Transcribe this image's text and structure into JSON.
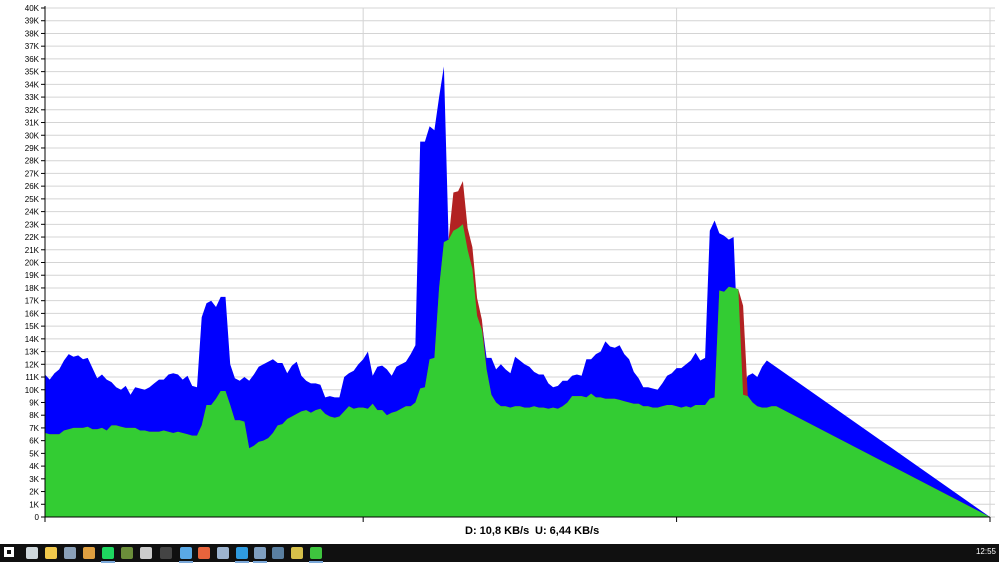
{
  "chart_data": {
    "type": "area",
    "title": "",
    "xlabel": "",
    "ylabel": "",
    "ylim": [
      0,
      40000
    ],
    "grid": true,
    "legend": "none",
    "y_ticks": [
      0,
      1000,
      2000,
      3000,
      4000,
      5000,
      6000,
      7000,
      8000,
      9000,
      10000,
      11000,
      12000,
      13000,
      14000,
      15000,
      16000,
      17000,
      18000,
      19000,
      20000,
      21000,
      22000,
      23000,
      24000,
      25000,
      26000,
      27000,
      28000,
      29000,
      30000,
      31000,
      32000,
      33000,
      34000,
      35000,
      36000,
      37000,
      38000,
      39000,
      40000
    ],
    "y_tick_labels": [
      "0",
      "1K",
      "2K",
      "3K",
      "4K",
      "5K",
      "6K",
      "7K",
      "8K",
      "9K",
      "10K",
      "11K",
      "12K",
      "13K",
      "14K",
      "15K",
      "16K",
      "17K",
      "18K",
      "19K",
      "20K",
      "21K",
      "22K",
      "23K",
      "24K",
      "25K",
      "26K",
      "27K",
      "28K",
      "29K",
      "30K",
      "31K",
      "32K",
      "33K",
      "34K",
      "35K",
      "36K",
      "37K",
      "38K",
      "39K",
      "40K"
    ],
    "x": [
      0,
      1,
      2,
      3,
      4,
      5,
      6,
      7,
      8,
      9,
      10,
      11,
      12,
      13,
      14,
      15,
      16,
      17,
      18,
      19,
      20,
      21,
      22,
      23,
      24,
      25,
      26,
      27,
      28,
      29,
      30,
      31,
      32,
      33,
      34,
      35,
      36,
      37,
      38,
      39,
      40,
      41,
      42,
      43,
      44,
      45,
      46,
      47,
      48,
      49,
      50,
      51,
      52,
      53,
      54,
      55,
      56,
      57,
      58,
      59,
      60,
      61,
      62,
      63,
      64,
      65,
      66,
      67,
      68,
      69,
      70,
      71,
      72,
      73,
      74,
      75,
      76,
      77,
      78,
      79,
      80,
      81,
      82,
      83,
      84,
      85,
      86,
      87,
      88,
      89,
      90,
      91,
      92,
      93,
      94,
      95,
      96,
      97,
      98,
      99,
      100,
      101,
      102,
      103,
      104,
      105,
      106,
      107,
      108,
      109,
      110,
      111,
      112,
      113,
      114,
      115,
      116,
      117,
      118,
      119,
      120,
      121,
      122,
      123,
      124,
      125,
      126,
      127,
      128,
      129,
      130,
      131,
      132,
      133,
      134,
      135,
      136,
      137,
      138,
      139,
      140,
      141,
      142,
      143,
      144,
      145,
      146,
      147,
      148,
      149,
      150,
      151,
      152,
      153,
      154,
      155,
      156,
      157,
      158,
      159,
      160,
      161,
      162,
      163,
      164,
      165,
      166,
      167,
      168,
      169,
      170,
      171,
      172,
      173,
      174,
      175,
      176,
      177,
      178,
      179,
      180,
      181,
      182,
      183,
      184,
      185,
      186,
      187,
      188,
      189,
      190,
      191,
      192,
      193,
      194,
      195,
      196,
      197,
      198,
      199
    ],
    "x_tick_positions": [
      0,
      67,
      133,
      199
    ],
    "series": [
      {
        "color": "#0000ff",
        "values": [
          11200,
          10800,
          11300,
          11600,
          12300,
          12800,
          12600,
          12700,
          12400,
          12500,
          11700,
          10900,
          11200,
          10800,
          10600,
          10200,
          10000,
          10300,
          9600,
          10200,
          10100,
          10000,
          10200,
          10500,
          10800,
          10800,
          11200,
          11300,
          11200,
          10800,
          11100,
          10300,
          10200,
          15700,
          16800,
          17000,
          16500,
          17300,
          17300,
          12000,
          10900,
          10700,
          11000,
          10700,
          11200,
          11800,
          12000,
          12200,
          12400,
          12100,
          12100,
          11300,
          11900,
          12200,
          11100,
          10700,
          10500,
          10500,
          10400,
          9400,
          9500,
          9400,
          9400,
          11000,
          11300,
          11500,
          12000,
          12400,
          13000,
          11100,
          11800,
          11900,
          11600,
          11100,
          11800,
          12000,
          12200,
          12800,
          13500,
          29500,
          29500,
          30700,
          30400,
          33000,
          35400,
          21800,
          22500,
          22700,
          22700,
          21300,
          19000,
          16800,
          15300,
          12500,
          12500,
          11600,
          12000,
          11600,
          11300,
          12600,
          12300,
          12000,
          11800,
          11400,
          11200,
          11200,
          10500,
          10200,
          10300,
          10700,
          10700,
          11100,
          11200,
          11100,
          12400,
          12400,
          12800,
          13000,
          13800,
          13400,
          13300,
          13500,
          12800,
          12400,
          11400,
          10900,
          10200,
          10200,
          10100,
          10000,
          10500,
          11100,
          11300,
          11700,
          11700,
          12000,
          12300,
          12900,
          12300,
          12500,
          22500,
          23300,
          22300,
          22100,
          21800,
          22000,
          12800,
          10300,
          11100,
          11300,
          11000,
          11800,
          12300
        ],
        "name": ""
      },
      {
        "color": "#b22222",
        "values": [
          6600,
          6500,
          6500,
          6500,
          6800,
          6900,
          7000,
          7000,
          7000,
          7100,
          6900,
          6900,
          7000,
          6800,
          7200,
          7200,
          7100,
          7000,
          7000,
          7000,
          6800,
          6800,
          6700,
          6700,
          6700,
          6800,
          6700,
          6600,
          6700,
          6600,
          6500,
          6400,
          6400,
          7200,
          8800,
          8800,
          9300,
          9900,
          9900,
          8800,
          7600,
          7600,
          7500,
          5400,
          5600,
          5900,
          6000,
          6200,
          6600,
          7200,
          7300,
          7700,
          7900,
          8100,
          8300,
          8400,
          8200,
          8400,
          8500,
          8100,
          7900,
          7800,
          7900,
          8300,
          8700,
          8500,
          8600,
          8600,
          8500,
          8900,
          8400,
          8400,
          8000,
          8200,
          8300,
          8500,
          8700,
          8700,
          9000,
          10100,
          10200,
          12400,
          12500,
          18000,
          21600,
          21800,
          25500,
          25600,
          26400,
          22700,
          21200,
          17200,
          15500,
          11600,
          9600,
          9000,
          8700,
          8700,
          8600,
          8700,
          8700,
          8600,
          8600,
          8700,
          8600,
          8600,
          8500,
          8600,
          8500,
          8700,
          9000,
          9500,
          9500,
          9500,
          9400,
          9700,
          9400,
          9400,
          9300,
          9300,
          9300,
          9200,
          9100,
          9000,
          8900,
          8900,
          8700,
          8700,
          8600,
          8600,
          8700,
          8800,
          8800,
          8700,
          8600,
          8700,
          8600,
          8800,
          8800,
          8800,
          9300,
          9400,
          17800,
          17700,
          18100,
          18000,
          17900,
          16600,
          9500,
          9000,
          8700,
          8600,
          8600,
          8700,
          8700
        ],
        "name": ""
      },
      {
        "color": "#33cc33",
        "values": [
          6600,
          6500,
          6500,
          6500,
          6800,
          6900,
          7000,
          7000,
          7000,
          7100,
          6900,
          6900,
          7000,
          6800,
          7200,
          7200,
          7100,
          7000,
          7000,
          7000,
          6800,
          6800,
          6700,
          6700,
          6700,
          6800,
          6700,
          6600,
          6700,
          6600,
          6500,
          6400,
          6400,
          7200,
          8800,
          8800,
          9300,
          9900,
          9900,
          8800,
          7600,
          7600,
          7500,
          5400,
          5600,
          5900,
          6000,
          6200,
          6600,
          7200,
          7300,
          7700,
          7900,
          8100,
          8300,
          8400,
          8200,
          8400,
          8500,
          8100,
          7900,
          7800,
          7900,
          8300,
          8700,
          8500,
          8600,
          8600,
          8500,
          8900,
          8400,
          8400,
          8000,
          8200,
          8300,
          8500,
          8700,
          8700,
          9000,
          10100,
          10200,
          12400,
          12500,
          18000,
          21600,
          21800,
          22500,
          22700,
          23000,
          21000,
          19500,
          15800,
          14700,
          11600,
          9600,
          9000,
          8700,
          8700,
          8600,
          8700,
          8700,
          8600,
          8600,
          8700,
          8600,
          8600,
          8500,
          8600,
          8500,
          8700,
          9000,
          9500,
          9500,
          9500,
          9400,
          9700,
          9400,
          9400,
          9300,
          9300,
          9300,
          9200,
          9100,
          9000,
          8900,
          8900,
          8700,
          8700,
          8600,
          8600,
          8700,
          8800,
          8800,
          8700,
          8600,
          8700,
          8600,
          8800,
          8800,
          8800,
          9300,
          9400,
          17800,
          17700,
          18100,
          18000,
          17900,
          9600,
          9500,
          9000,
          8700,
          8600,
          8600,
          8700,
          8700
        ],
        "name": ""
      }
    ],
    "colors": {
      "grid": "#d4d4d4",
      "axis": "#000000",
      "background": "#ffffff"
    }
  },
  "status": {
    "download": "D: 10,8 KB/s",
    "upload": "U: 6,44 KB/s"
  },
  "taskbar": {
    "clock": "12:55",
    "icons": [
      {
        "name": "start-menu-icon",
        "color": "#ffffff",
        "active": false
      },
      {
        "name": "task-view-icon",
        "color": "#cfd8dc",
        "active": false
      },
      {
        "name": "file-explorer-icon",
        "color": "#f2c94c",
        "active": false
      },
      {
        "name": "media-icon",
        "color": "#8aa0b8",
        "active": false
      },
      {
        "name": "chrome-icon",
        "color": "#e0a040",
        "active": false
      },
      {
        "name": "spotify-icon",
        "color": "#1ed760",
        "active": true
      },
      {
        "name": "minecraft-icon",
        "color": "#6b8e3a",
        "active": false
      },
      {
        "name": "terminal-icon",
        "color": "#cccccc",
        "active": false
      },
      {
        "name": "app-icon",
        "color": "#444444",
        "active": false
      },
      {
        "name": "browser-icon",
        "color": "#5aa9e6",
        "active": true
      },
      {
        "name": "brave-icon",
        "color": "#e8643c",
        "active": false
      },
      {
        "name": "steam-icon",
        "color": "#9db4d0",
        "active": false
      },
      {
        "name": "vscode-icon",
        "color": "#2f9be0",
        "active": true
      },
      {
        "name": "window-icon",
        "color": "#7f9fc0",
        "active": true
      },
      {
        "name": "tool-icon",
        "color": "#5a7fa0",
        "active": false
      },
      {
        "name": "gauge-icon",
        "color": "#d6c04a",
        "active": false
      },
      {
        "name": "network-monitor-icon",
        "color": "#3ec43e",
        "active": true
      }
    ]
  }
}
